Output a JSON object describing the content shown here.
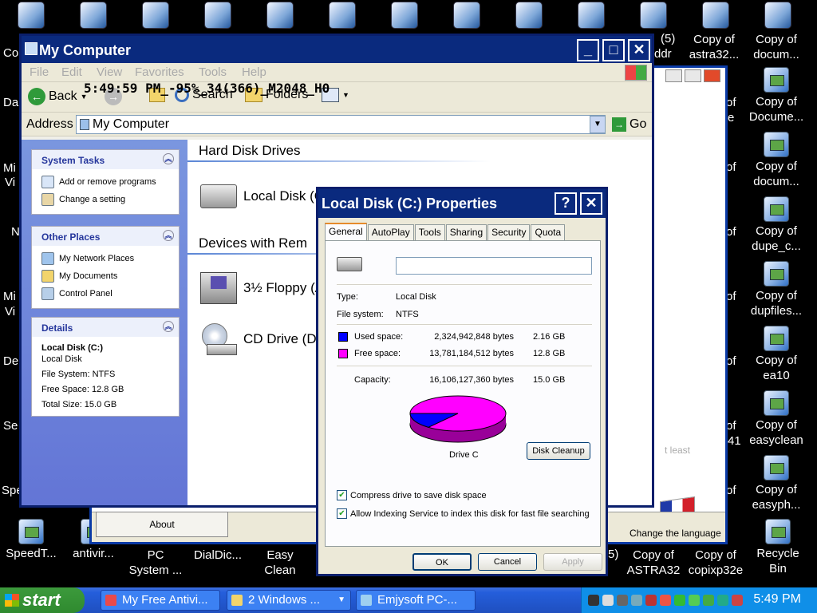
{
  "desktop": {
    "left_edge": [
      "Co",
      "Da",
      "Mi",
      "Vi",
      "N",
      "Mi",
      "Vi",
      "De",
      "Se",
      "Spe"
    ],
    "right_col_labels": [
      "(5)",
      "ddr"
    ],
    "right_icons": [
      {
        "l1": "Copy of",
        "l2": "astra32..."
      },
      {
        "l1": "Copy of",
        "l2": "docum..."
      },
      {
        "l1": "Copy of",
        "l2": "Docume..."
      },
      {
        "l1": "Copy of",
        "l2": "docum..."
      },
      {
        "l1": "Copy of",
        "l2": "dupe_c..."
      },
      {
        "l1": "Copy of",
        "l2": "dupfiles..."
      },
      {
        "l1": "Copy of",
        "l2": "ea10"
      },
      {
        "l1": "Copy of",
        "l2": "easyclean"
      },
      {
        "l1": "Copy of",
        "l2": "easyph..."
      }
    ],
    "of_labels": [
      "of",
      "e",
      "of",
      "of",
      "of",
      "of",
      "of",
      "of",
      "41",
      "of"
    ],
    "bottom_icons": [
      {
        "l1": "SpeedT...",
        "l2": ""
      },
      {
        "l1": "antivir...",
        "l2": ""
      },
      {
        "l1": "PC",
        "l2": "System ..."
      },
      {
        "l1": "DialDic...",
        "l2": ""
      },
      {
        "l1": "Easy",
        "l2": "Clean"
      },
      {
        "l1": "Copy of",
        "l2": "ASTRA32"
      },
      {
        "l1": "Copy of",
        "l2": "copixp32e"
      },
      {
        "l1": "Recycle",
        "l2": "Bin"
      }
    ],
    "bottom_fragment": "5)"
  },
  "bg_window": {
    "about_label": "About",
    "least_text": "t least",
    "change_language": "Change the language"
  },
  "explorer": {
    "title": "My Computer",
    "menu": [
      "File",
      "Edit",
      "View",
      "Favorites",
      "Tools",
      "Help"
    ],
    "overlay_text": "5:49:59 PM_-95%_34(366)_M2048_H0",
    "toolbar": {
      "back": "Back",
      "search": "Search",
      "folders": "Folders"
    },
    "address_label": "Address",
    "address_value": "My Computer",
    "go_label": "Go",
    "system_tasks": {
      "title": "System Tasks",
      "items": [
        "Add or remove programs",
        "Change a setting"
      ]
    },
    "other_places": {
      "title": "Other Places",
      "items": [
        "My Network Places",
        "My Documents",
        "Control Panel"
      ]
    },
    "details": {
      "title": "Details",
      "name": "Local Disk (C:)",
      "type": "Local Disk",
      "fs": "File System: NTFS",
      "free": "Free Space: 12.8 GB",
      "total": "Total Size: 15.0 GB"
    },
    "hard_disk_heading": "Hard Disk Drives",
    "local_disk_label": "Local Disk (C",
    "devices_heading": "Devices with Rem",
    "floppy_label": "3½ Floppy (A",
    "cd_label": "CD Drive (D:"
  },
  "properties": {
    "title": "Local Disk (C:) Properties",
    "tabs": [
      "General",
      "AutoPlay",
      "Tools",
      "Sharing",
      "Security",
      "Quota"
    ],
    "name_value": "",
    "type_label": "Type:",
    "type_value": "Local Disk",
    "fs_label": "File system:",
    "fs_value": "NTFS",
    "used_label": "Used space:",
    "used_bytes": "2,324,942,848 bytes",
    "used_gb": "2.16 GB",
    "free_label": "Free space:",
    "free_bytes": "13,781,184,512 bytes",
    "free_gb": "12.8 GB",
    "capacity_label": "Capacity:",
    "capacity_bytes": "16,106,127,360 bytes",
    "capacity_gb": "15.0 GB",
    "drive_label": "Drive C",
    "cleanup_label": "Disk Cleanup",
    "compress_label": "Compress drive to save disk space",
    "index_label": "Allow Indexing Service to index this disk for fast file searching",
    "ok_label": "OK",
    "cancel_label": "Cancel",
    "apply_label": "Apply",
    "used_color": "#0000ff",
    "free_color": "#ff00ff",
    "used_fraction": 0.1444
  },
  "taskbar": {
    "start_label": "start",
    "buttons": [
      "My Free Antivi...",
      "2 Windows ...",
      "Emjysoft PC-..."
    ],
    "clock": "5:49 PM"
  }
}
